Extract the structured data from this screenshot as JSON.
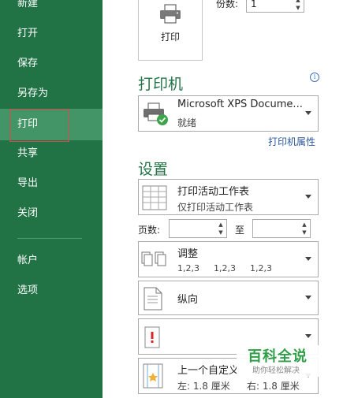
{
  "sidebar": {
    "items": [
      {
        "label": "新建"
      },
      {
        "label": "打开"
      },
      {
        "label": "保存"
      },
      {
        "label": "另存为"
      },
      {
        "label": "打印"
      },
      {
        "label": "共享"
      },
      {
        "label": "导出"
      },
      {
        "label": "关闭"
      },
      {
        "label": "帐户"
      },
      {
        "label": "选项"
      }
    ],
    "active": "打印"
  },
  "print": {
    "button_label": "打印",
    "copies_label": "份数:",
    "copies_value": "1"
  },
  "printer": {
    "section_title": "打印机",
    "name": "Microsoft XPS Docume...",
    "status": "就绪",
    "properties_link": "打印机属性"
  },
  "settings": {
    "section_title": "设置",
    "scope": {
      "title": "打印活动工作表",
      "subtitle": "仅打印活动工作表"
    },
    "pages_label": "页数:",
    "pages_to_label": "至",
    "collate": {
      "title": "调整",
      "sequence": [
        "1,2,3",
        "1,2,3",
        "1,2,3"
      ]
    },
    "orientation": {
      "title": "纵向"
    },
    "margins": {
      "title": "上一个自定义",
      "subtitle_left": "左: 1.8 厘米",
      "subtitle_right": "右: 1.8 厘米"
    }
  },
  "watermark": {
    "title": "百科全说",
    "subtitle": "助你轻松解决"
  },
  "colors": {
    "sidebar_bg": "#217346",
    "sidebar_active": "#439467",
    "accent_green": "#217346",
    "link_blue": "#2b579a",
    "highlight_red": "#e0454b"
  }
}
